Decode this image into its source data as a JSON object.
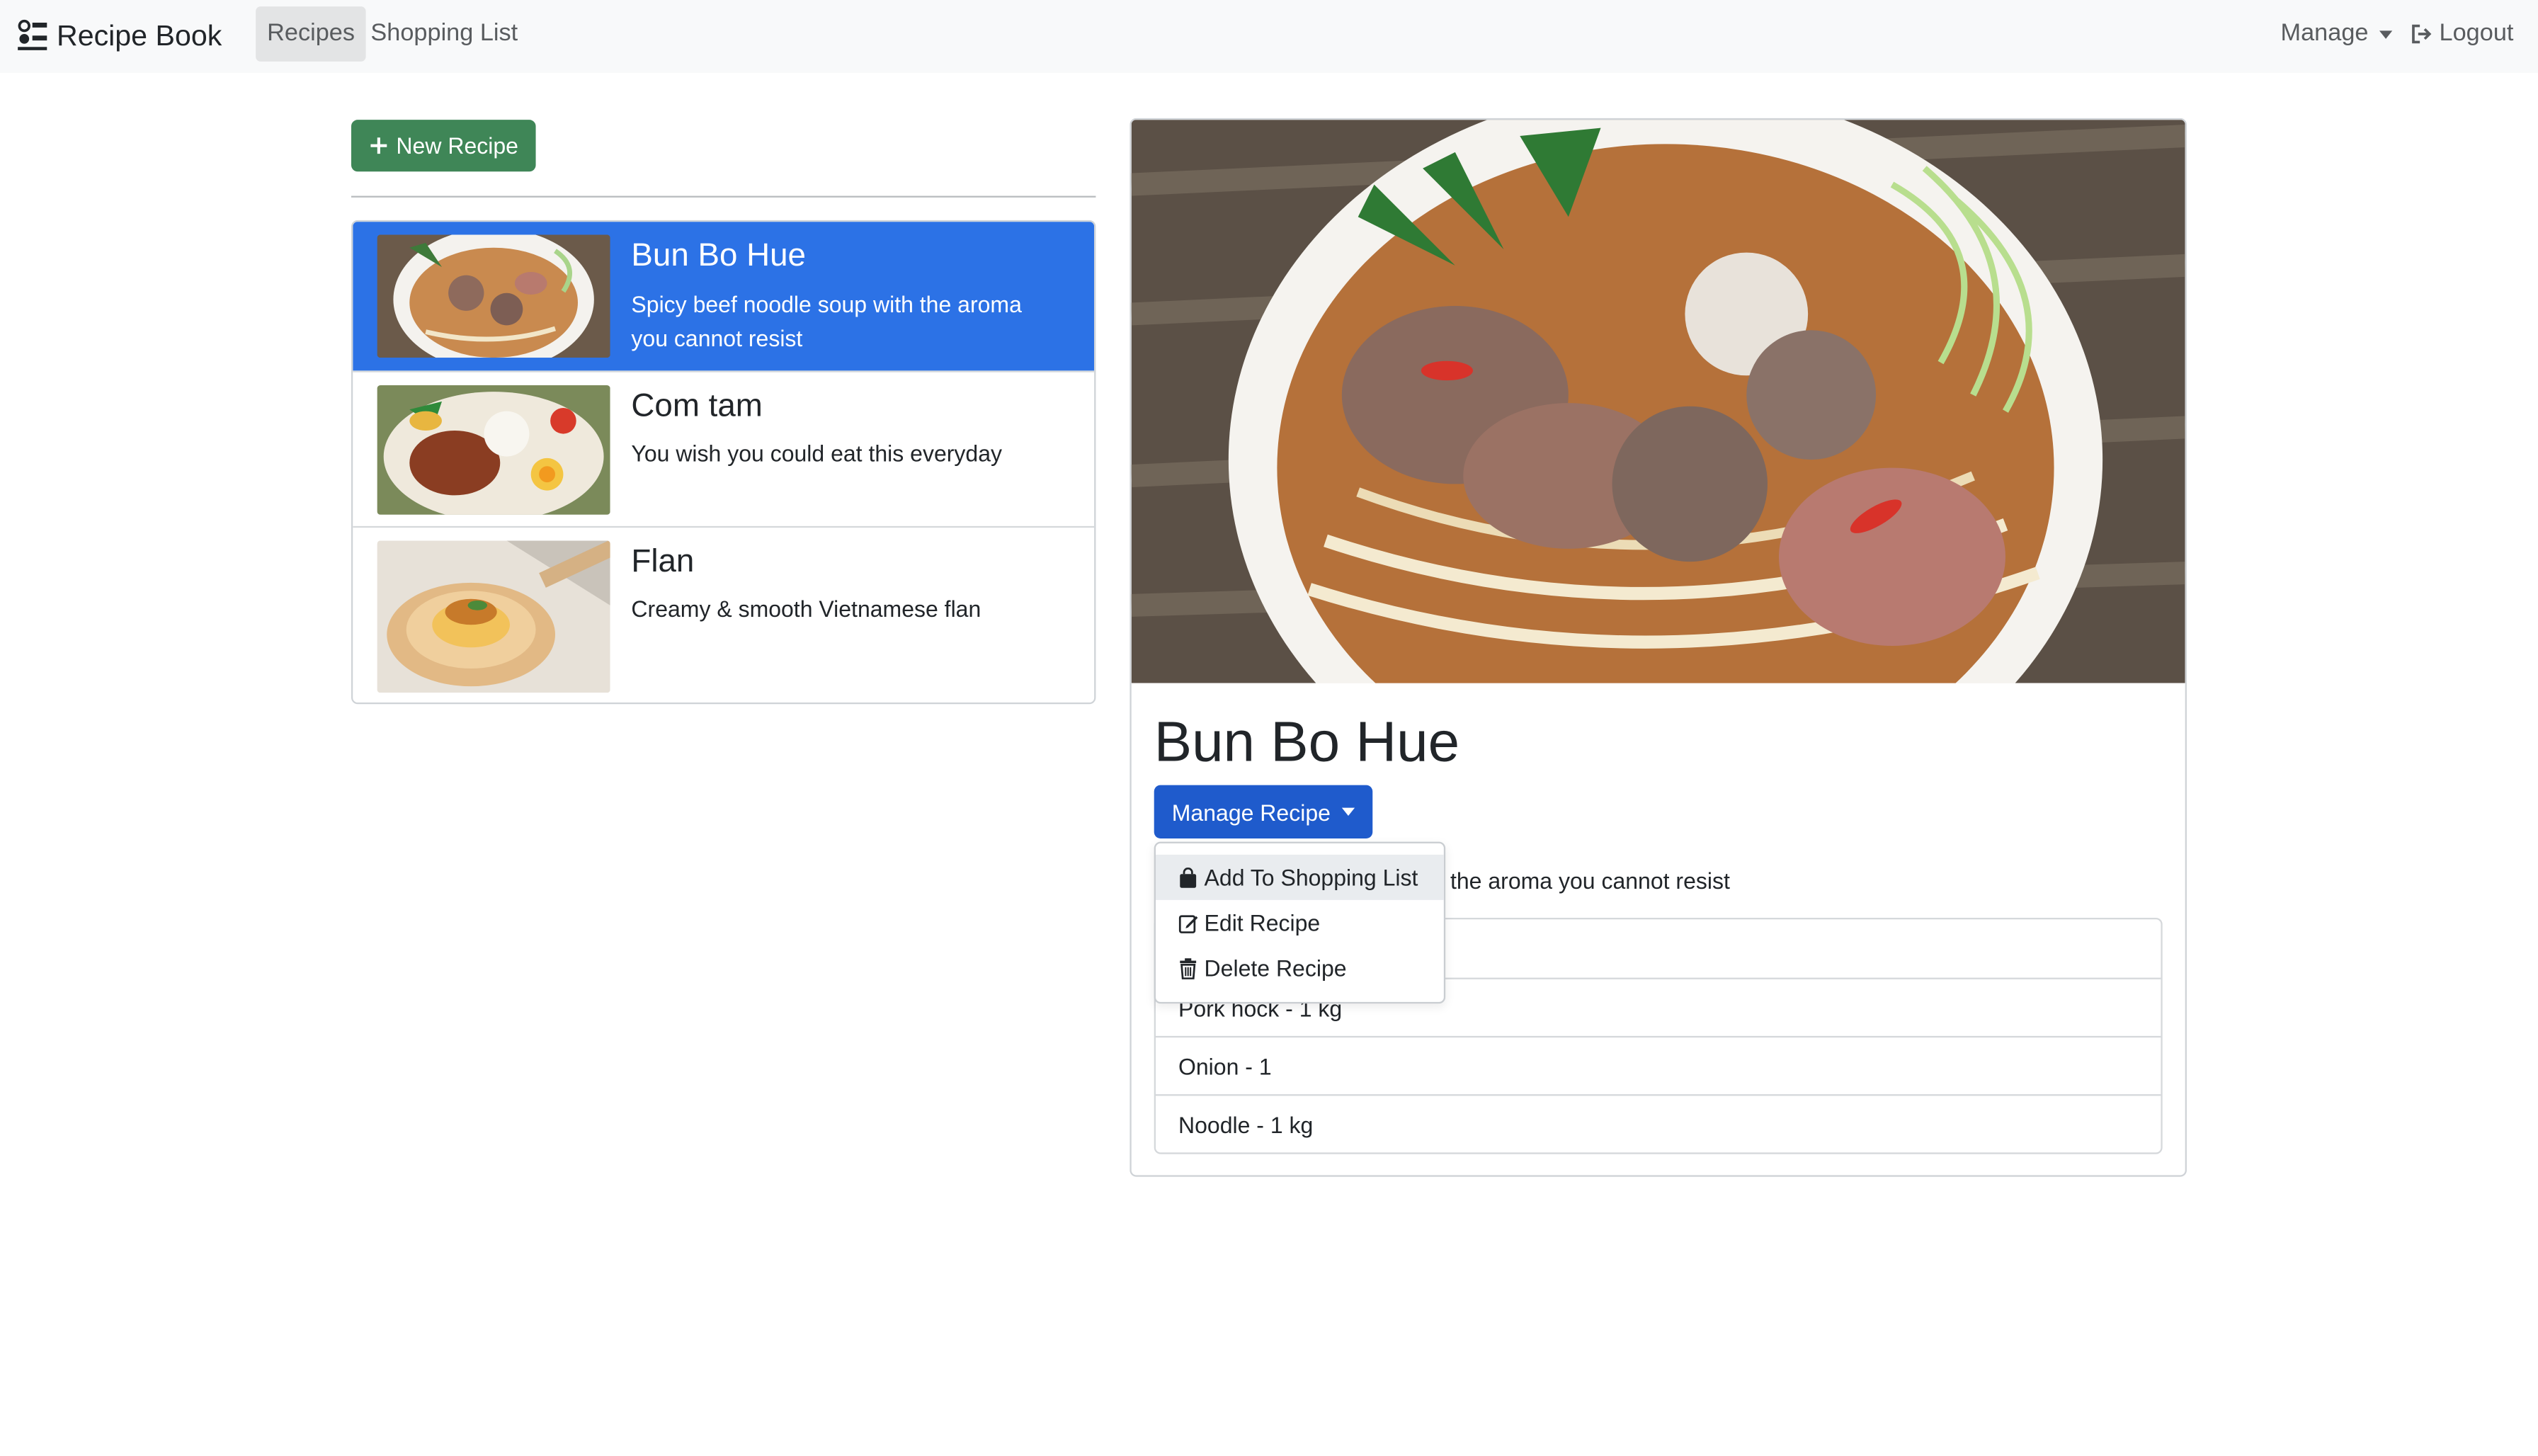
{
  "navbar": {
    "brand": "Recipe Book",
    "links": [
      {
        "label": "Recipes",
        "active": true
      },
      {
        "label": "Shopping List",
        "active": false
      }
    ],
    "manage_label": "Manage",
    "logout_label": "Logout"
  },
  "sidebar": {
    "new_recipe_label": "New Recipe",
    "recipes": [
      {
        "title": "Bun Bo Hue",
        "description": "Spicy beef noodle soup with the aroma you cannot resist",
        "active": true,
        "thumbnail": "bun-bo-hue-photo"
      },
      {
        "title": "Com tam",
        "description": "You wish you could eat this everyday",
        "active": false,
        "thumbnail": "com-tam-photo"
      },
      {
        "title": "Flan",
        "description": "Creamy & smooth Vietnamese flan",
        "active": false,
        "thumbnail": "flan-photo"
      }
    ]
  },
  "detail": {
    "title": "Bun Bo Hue",
    "manage_button_label": "Manage Recipe",
    "description_visible": "the aroma you cannot resist",
    "ingredients": [
      "",
      "Pork hock - 1 kg",
      "Onion - 1",
      "Noodle - 1 kg"
    ]
  },
  "dropdown": {
    "items": [
      {
        "label": "Add To Shopping List",
        "icon": "shopping-bag-icon",
        "highlighted": true
      },
      {
        "label": "Edit Recipe",
        "icon": "edit-icon",
        "highlighted": false
      },
      {
        "label": "Delete Recipe",
        "icon": "trash-icon",
        "highlighted": false
      }
    ]
  },
  "colors": {
    "active_list_item": "#2c72e6",
    "new_recipe_button": "#3f8657",
    "manage_recipe_button": "#1f5bcc",
    "navbar_bg": "#f8f9fa"
  }
}
